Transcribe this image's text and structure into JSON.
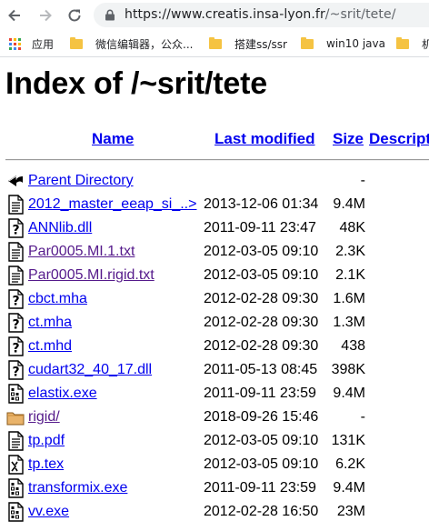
{
  "browser": {
    "url_host": "https://www.creatis.insa-lyon.fr",
    "url_path": "/~srit/tete/",
    "bookmarks": [
      {
        "label": "应用",
        "icon": "apps-grid-icon"
      },
      {
        "label": "微信编辑器，公众...",
        "icon": "folder-icon"
      },
      {
        "label": "搭建ss/ssr",
        "icon": "folder-icon"
      },
      {
        "label": "win10 java",
        "icon": "folder-icon"
      },
      {
        "label": "机器",
        "icon": "folder-icon"
      }
    ]
  },
  "page": {
    "title": "Index of /~srit/tete",
    "columns": {
      "name": "Name",
      "modified": "Last modified",
      "size": "Size",
      "description": "Description"
    },
    "rows": [
      {
        "icon": "back-arrow-icon",
        "name": "Parent Directory",
        "date": "",
        "size": "-",
        "visited": false
      },
      {
        "icon": "text-file-icon",
        "name": "2012_master_eeap_si_..>",
        "date": "2013-12-06 01:34",
        "size": "9.4M",
        "visited": false
      },
      {
        "icon": "unknown-file-icon",
        "name": "ANNlib.dll",
        "date": "2011-09-11 23:47",
        "size": "48K",
        "visited": false
      },
      {
        "icon": "text-file-icon",
        "name": "Par0005.MI.1.txt",
        "date": "2012-03-05 09:10",
        "size": "2.3K",
        "visited": true
      },
      {
        "icon": "text-file-icon",
        "name": "Par0005.MI.rigid.txt",
        "date": "2012-03-05 09:10",
        "size": "2.1K",
        "visited": true
      },
      {
        "icon": "unknown-file-icon",
        "name": "cbct.mha",
        "date": "2012-02-28 09:30",
        "size": "1.6M",
        "visited": false
      },
      {
        "icon": "unknown-file-icon",
        "name": "ct.mha",
        "date": "2012-02-28 09:30",
        "size": "1.3M",
        "visited": false
      },
      {
        "icon": "unknown-file-icon",
        "name": "ct.mhd",
        "date": "2012-02-28 09:30",
        "size": "438",
        "visited": false
      },
      {
        "icon": "unknown-file-icon",
        "name": "cudart32_40_17.dll",
        "date": "2011-05-13 08:45",
        "size": "398K",
        "visited": false
      },
      {
        "icon": "binary-file-icon",
        "name": "elastix.exe",
        "date": "2011-09-11 23:59",
        "size": "9.4M",
        "visited": false
      },
      {
        "icon": "folder-icon",
        "name": "rigid/",
        "date": "2018-09-26 15:46",
        "size": "-",
        "visited": true
      },
      {
        "icon": "text-file-icon",
        "name": "tp.pdf",
        "date": "2012-03-05 09:10",
        "size": "131K",
        "visited": false
      },
      {
        "icon": "tex-file-icon",
        "name": "tp.tex",
        "date": "2012-03-05 09:10",
        "size": "6.2K",
        "visited": false
      },
      {
        "icon": "binary-file-icon",
        "name": "transformix.exe",
        "date": "2011-09-11 23:59",
        "size": "9.4M",
        "visited": false
      },
      {
        "icon": "binary-file-icon",
        "name": "vv.exe",
        "date": "2012-02-28 16:50",
        "size": "23M",
        "visited": false
      }
    ]
  }
}
